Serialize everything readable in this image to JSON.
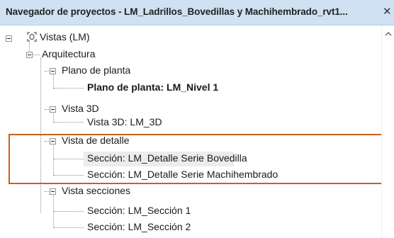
{
  "window": {
    "title": "Navegador de proyectos - LM_Ladrillos_Bovedillas y Machihembrado_rvt1...",
    "close_glyph": "✕"
  },
  "tree": {
    "root": "Vistas (LM)",
    "category": "Arquitectura",
    "groups": [
      {
        "label": "Plano de planta",
        "items": [
          "Plano de planta: LM_Nivel 1"
        ]
      },
      {
        "label": "Vista 3D",
        "items": [
          "Vista 3D: LM_3D"
        ]
      },
      {
        "label": "Vista de detalle",
        "items": [
          "Sección: LM_Detalle Serie Bovedilla",
          "Sección: LM_Detalle Serie Machihembrado"
        ]
      },
      {
        "label": "Vista secciones",
        "items": [
          "Sección: LM_Sección 1",
          "Sección: LM_Sección 2"
        ]
      }
    ]
  },
  "colors": {
    "title_bar": "#cfe1f3",
    "highlight_border": "#c8611c",
    "selected_row": "#ececec"
  },
  "icons": {
    "views": "views-icon",
    "collapse": "minus-box-icon",
    "scroll_up": "chevron-up-icon"
  }
}
